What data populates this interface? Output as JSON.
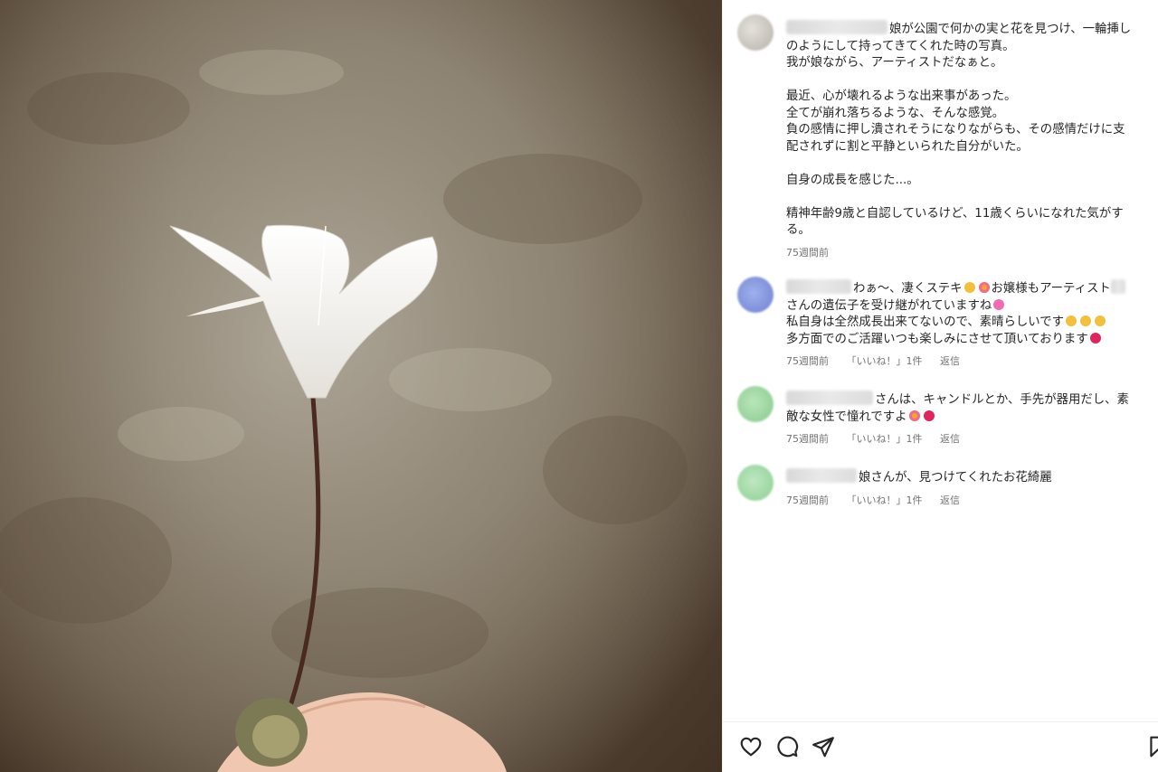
{
  "post": {
    "caption_lines": [
      "娘が公園で何かの実と花を見つけ、一輪挿し",
      "のようにして持ってきてくれた時の写真。",
      "我が娘ながら、アーティストだなぁと。",
      "",
      "最近、心が壊れるような出来事があった。",
      "全てが崩れ落ちるような、そんな感覚。",
      "負の感情に押し潰されそうになりながらも、その感情だけに支",
      "配されずに割と平静といられた自分がいた。",
      "",
      "自身の成長を感じた...。",
      "",
      "精神年齢9歳と自認しているけど、11歳くらいになれた気がす",
      "る。"
    ],
    "time": "75週間前"
  },
  "comments": [
    {
      "lines": [
        "わぁ～、凄くステキ",
        "お嬢様もアーティスト",
        "さんの遺伝子を受け継がれていますね",
        "私自身は全然成長出来てないので、素晴らしいです",
        "多方面でのご活躍いつも楽しみにさせて頂いております"
      ],
      "time": "75週間前",
      "likes": "「いいね！」1件",
      "reply": "返信"
    },
    {
      "lines": [
        "さんは、キャンドルとか、手先が器用だし、素",
        "敵な女性で憧れですよ"
      ],
      "time": "75週間前",
      "likes": "「いいね！」1件",
      "reply": "返信"
    },
    {
      "lines": [
        "娘さんが、見つけてくれたお花綺麗"
      ],
      "time": "75週間前",
      "likes": "「いいね！」1件",
      "reply": "返信"
    }
  ],
  "icons": [
    "heart-icon",
    "comment-icon",
    "share-icon",
    "bookmark-icon"
  ],
  "colors": {
    "avatar_main": "#c9c6bf",
    "avatar_blue": "#7f8fd6",
    "avatar_green": "#8fcf93",
    "heart_red": "#e0245e",
    "muted": "#737373"
  }
}
